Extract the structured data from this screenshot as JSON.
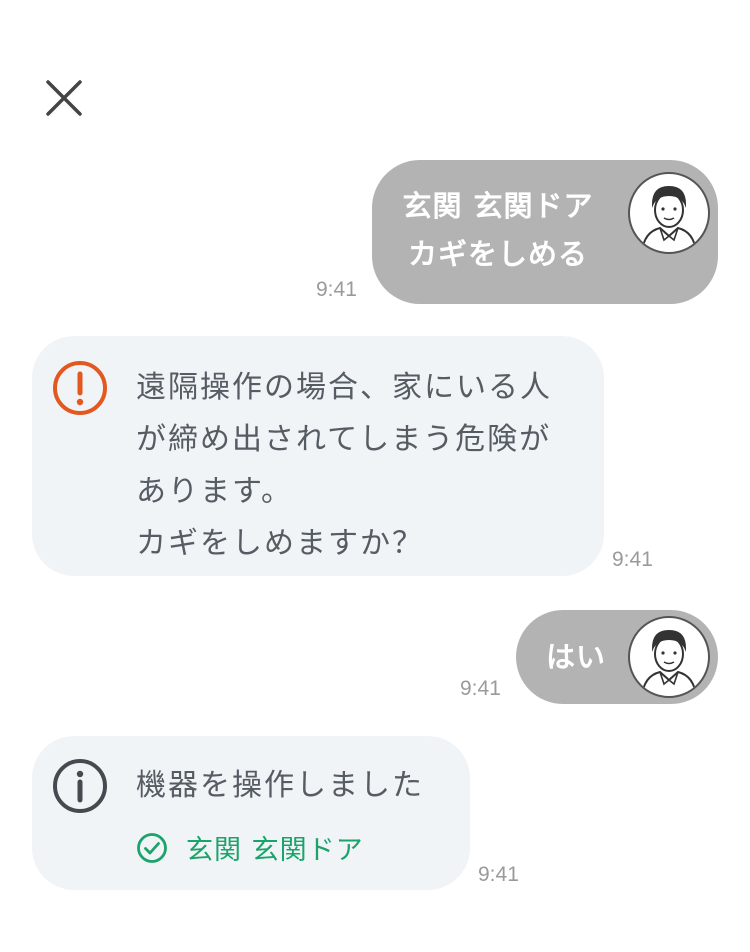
{
  "header": {
    "close_icon": "close-icon"
  },
  "messages": [
    {
      "kind": "user",
      "lines": [
        "玄関 玄関ドア",
        "カギをしめる"
      ],
      "time": "9:41",
      "avatar_icon": "user-avatar-icon"
    },
    {
      "kind": "system-warning",
      "icon": "warning-icon",
      "icon_color": "#e2581f",
      "lines": [
        "遠隔操作の場合、家にいる人",
        "が締め出されてしまう危険が",
        "あります。",
        "カギをしめますか？"
      ],
      "time": "9:41"
    },
    {
      "kind": "user",
      "lines": [
        "はい"
      ],
      "time": "9:41",
      "avatar_icon": "user-avatar-icon"
    },
    {
      "kind": "system-info",
      "icon": "info-icon",
      "text": "機器を操作しました",
      "device": {
        "icon": "check-circle-icon",
        "label": "玄関 玄関ドア",
        "color": "#1aa36a"
      },
      "time": "9:41"
    }
  ],
  "colors": {
    "user_bubble": "#b3b3b3",
    "system_bubble": "#f1f4f7",
    "timestamp": "#9a9a9a"
  }
}
